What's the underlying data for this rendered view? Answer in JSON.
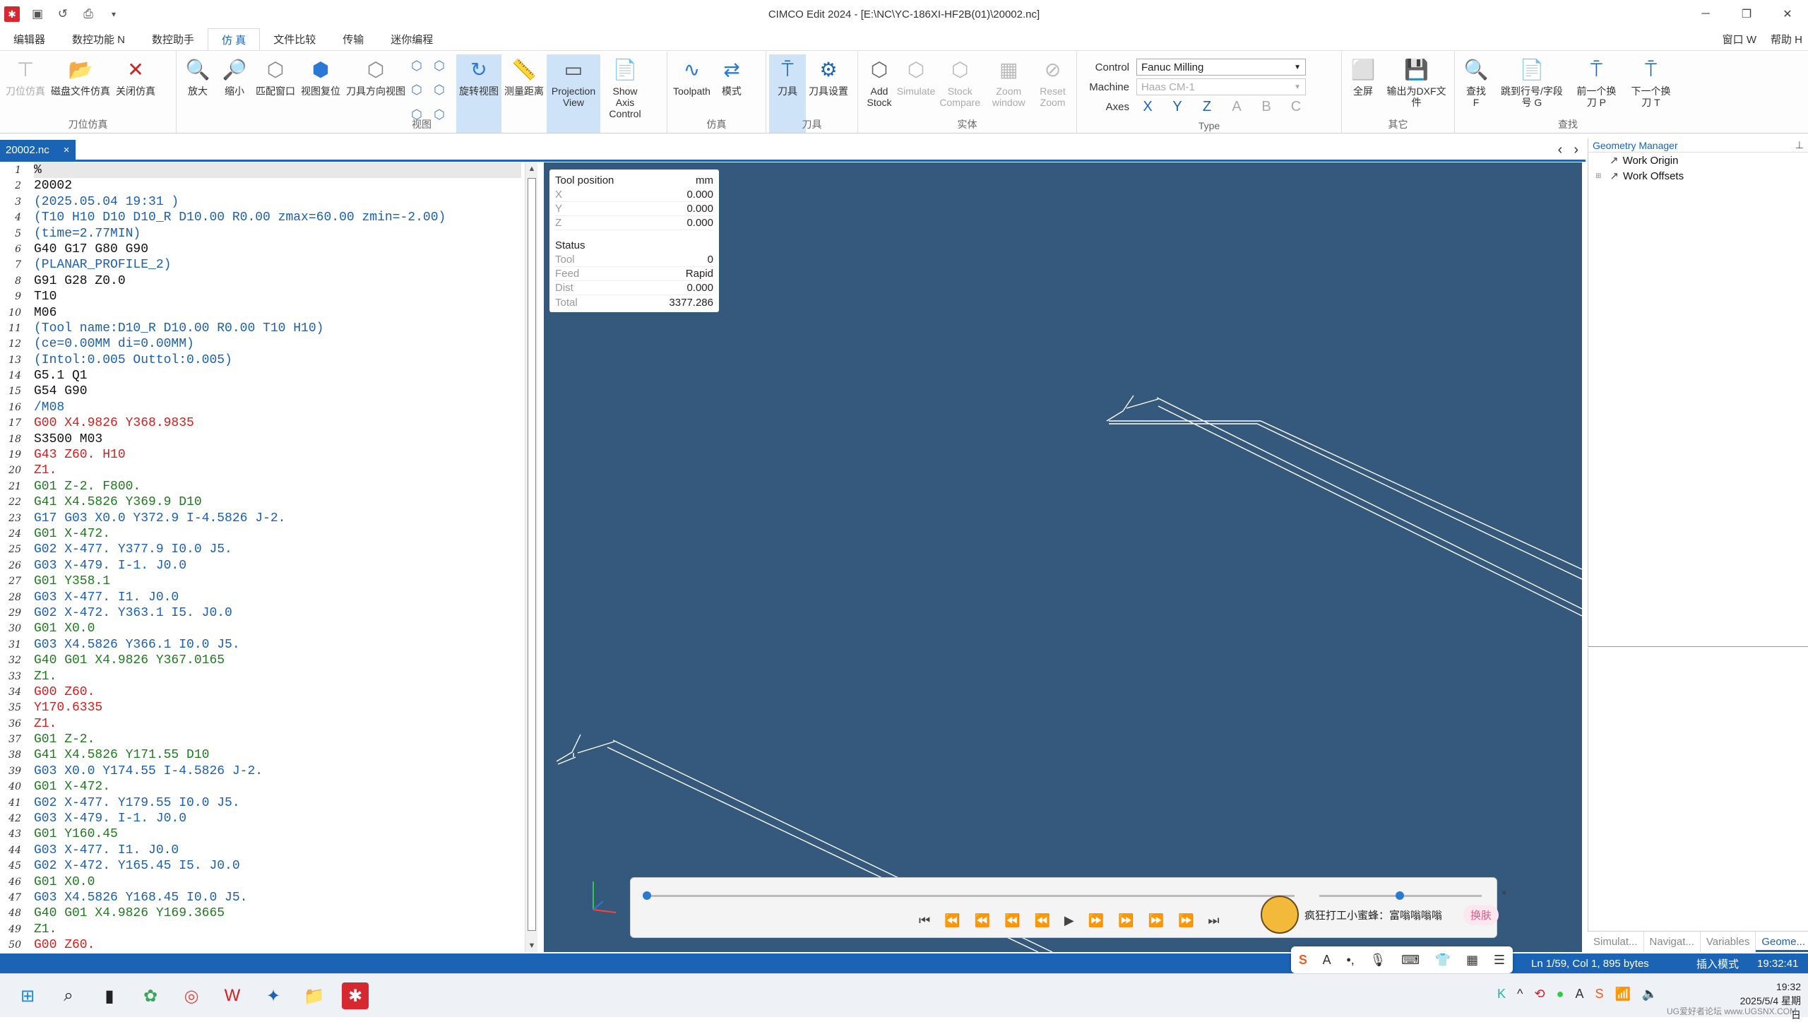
{
  "window": {
    "title": "CIMCO Edit 2024 - [E:\\NC\\YC-186XI-HF2B(01)\\20002.nc]",
    "min_icon": "minimize-icon",
    "restore_icon": "restore-icon",
    "close_icon": "close-icon"
  },
  "menubar": {
    "tabs": [
      "编辑器",
      "数控功能 N",
      "数控助手",
      "仿 真",
      "文件比较",
      "传输",
      "迷你编程"
    ],
    "active": "仿 真",
    "right": [
      "窗口 W",
      "帮助 H"
    ]
  },
  "ribbon": {
    "groups": [
      {
        "label": "刀位仿真",
        "buttons": [
          {
            "label": "刀位仿真",
            "icon": "tool-sim-icon",
            "enabled": false
          },
          {
            "label": "磁盘文件仿真",
            "icon": "folder-icon",
            "enabled": true
          },
          {
            "label": "关闭仿真",
            "icon": "close-x-icon",
            "enabled": true
          }
        ]
      },
      {
        "label": "视图",
        "buttons": [
          {
            "label": "放大",
            "icon": "zoom-in-icon",
            "enabled": true
          },
          {
            "label": "缩小",
            "icon": "zoom-out-icon",
            "enabled": true
          },
          {
            "label": "匹配窗口",
            "icon": "fit-window-icon",
            "enabled": true
          },
          {
            "label": "视图复位",
            "icon": "view-reset-icon",
            "enabled": true
          },
          {
            "label": "刀具方向视图",
            "icon": "tool-direction-icon",
            "enabled": true
          },
          {
            "label": "旋转视图",
            "icon": "rotate-view-icon",
            "enabled": true,
            "selected": true
          },
          {
            "label": "测量距离",
            "icon": "measure-icon",
            "enabled": true
          },
          {
            "label": "Projection View",
            "icon": "projection-icon",
            "enabled": true,
            "selected": true
          },
          {
            "label": "Show Axis Control",
            "icon": "axis-control-icon",
            "enabled": true
          }
        ]
      },
      {
        "label": "仿真",
        "buttons": [
          {
            "label": "Toolpath",
            "icon": "toolpath-icon",
            "enabled": true
          },
          {
            "label": "模式",
            "icon": "mode-icon",
            "enabled": true
          }
        ]
      },
      {
        "label": "刀具",
        "buttons": [
          {
            "label": "刀具",
            "icon": "tool-icon",
            "enabled": true,
            "selected": true
          },
          {
            "label": "刀具设置",
            "icon": "tool-settings-icon",
            "enabled": true
          }
        ]
      },
      {
        "label": "实体",
        "buttons": [
          {
            "label": "Add Stock",
            "icon": "add-stock-icon",
            "enabled": true
          },
          {
            "label": "Simulate",
            "icon": "simulate-icon",
            "enabled": false
          },
          {
            "label": "Stock Compare",
            "icon": "stock-compare-icon",
            "enabled": false
          },
          {
            "label": "Zoom window",
            "icon": "zoom-window-icon",
            "enabled": false
          },
          {
            "label": "Reset Zoom",
            "icon": "reset-zoom-icon",
            "enabled": false
          }
        ]
      },
      {
        "label": "其它",
        "buttons": [
          {
            "label": "全屏",
            "icon": "fullscreen-icon",
            "enabled": true
          },
          {
            "label": "输出为DXF文件",
            "icon": "dxf-icon",
            "enabled": true
          }
        ]
      },
      {
        "label": "查找",
        "buttons": [
          {
            "label": "查找 F",
            "icon": "find-icon",
            "enabled": true
          },
          {
            "label": "跳到行号/字段号 G",
            "icon": "goto-line-icon",
            "enabled": true
          },
          {
            "label": "前一个换刀 P",
            "icon": "prev-tool-icon",
            "enabled": true
          },
          {
            "label": "下一个换刀 T",
            "icon": "next-tool-icon",
            "enabled": true
          }
        ]
      }
    ],
    "type_group": {
      "label": "Type",
      "control_label": "Control",
      "control_value": "Fanuc Milling",
      "machine_label": "Machine",
      "machine_value": "Haas CM-1",
      "axes_label": "Axes",
      "axes": [
        {
          "name": "X",
          "enabled": true
        },
        {
          "name": "Y",
          "enabled": true
        },
        {
          "name": "Z",
          "enabled": true
        },
        {
          "name": "A",
          "enabled": false
        },
        {
          "name": "B",
          "enabled": false
        },
        {
          "name": "C",
          "enabled": false
        }
      ]
    }
  },
  "doc_tab": {
    "label": "20002.nc",
    "close": "×"
  },
  "editor": {
    "lines": [
      {
        "n": "1",
        "t": "%",
        "c": "black"
      },
      {
        "n": "2",
        "t": "20002",
        "c": "black"
      },
      {
        "n": "3",
        "t": "(2025.05.04 19:31 )",
        "c": "blue"
      },
      {
        "n": "4",
        "t": "(T10 H10 D10 D10_R D10.00 R0.00 zmax=60.00 zmin=-2.00)",
        "c": "blue"
      },
      {
        "n": "5",
        "t": "(time=2.77MIN)",
        "c": "blue"
      },
      {
        "n": "6",
        "t": "G40 G17 G80 G90",
        "c": "black"
      },
      {
        "n": "7",
        "t": "(PLANAR_PROFILE_2)",
        "c": "blue"
      },
      {
        "n": "8",
        "t": "G91 G28 Z0.0",
        "c": "black"
      },
      {
        "n": "9",
        "t": "T10",
        "c": "black"
      },
      {
        "n": "10",
        "t": "M06",
        "c": "black"
      },
      {
        "n": "11",
        "t": "(Tool name:D10_R D10.00 R0.00 T10 H10)",
        "c": "blue"
      },
      {
        "n": "12",
        "t": "(ce=0.00MM di=0.00MM)",
        "c": "blue"
      },
      {
        "n": "13",
        "t": "(Intol:0.005 Outtol:0.005)",
        "c": "blue"
      },
      {
        "n": "14",
        "t": "G5.1 Q1",
        "c": "black"
      },
      {
        "n": "15",
        "t": "G54 G90",
        "c": "black"
      },
      {
        "n": "16",
        "t": "/M08",
        "c": "blue"
      },
      {
        "n": "17",
        "t": "G00 X4.9826 Y368.9835",
        "c": "red"
      },
      {
        "n": "18",
        "t": "S3500 M03",
        "c": "black"
      },
      {
        "n": "19",
        "t": "G43 Z60. H10",
        "c": "red"
      },
      {
        "n": "20",
        "t": "Z1.",
        "c": "red"
      },
      {
        "n": "21",
        "t": "G01 Z-2. F800.",
        "c": "green"
      },
      {
        "n": "22",
        "t": "G41 X4.5826 Y369.9 D10",
        "c": "green"
      },
      {
        "n": "23",
        "t": "G17 G03 X0.0 Y372.9 I-4.5826 J-2.",
        "c": "blue"
      },
      {
        "n": "24",
        "t": "G01 X-472.",
        "c": "green"
      },
      {
        "n": "25",
        "t": "G02 X-477. Y377.9 I0.0 J5.",
        "c": "blue"
      },
      {
        "n": "26",
        "t": "G03 X-479. I-1. J0.0",
        "c": "blue"
      },
      {
        "n": "27",
        "t": "G01 Y358.1",
        "c": "green"
      },
      {
        "n": "28",
        "t": "G03 X-477. I1. J0.0",
        "c": "blue"
      },
      {
        "n": "29",
        "t": "G02 X-472. Y363.1 I5. J0.0",
        "c": "blue"
      },
      {
        "n": "30",
        "t": "G01 X0.0",
        "c": "green"
      },
      {
        "n": "31",
        "t": "G03 X4.5826 Y366.1 I0.0 J5.",
        "c": "blue"
      },
      {
        "n": "32",
        "t": "G40 G01 X4.9826 Y367.0165",
        "c": "green"
      },
      {
        "n": "33",
        "t": "Z1.",
        "c": "green"
      },
      {
        "n": "34",
        "t": "G00 Z60.",
        "c": "red"
      },
      {
        "n": "35",
        "t": "Y170.6335",
        "c": "red"
      },
      {
        "n": "36",
        "t": "Z1.",
        "c": "red"
      },
      {
        "n": "37",
        "t": "G01 Z-2.",
        "c": "green"
      },
      {
        "n": "38",
        "t": "G41 X4.5826 Y171.55 D10",
        "c": "green"
      },
      {
        "n": "39",
        "t": "G03 X0.0 Y174.55 I-4.5826 J-2.",
        "c": "blue"
      },
      {
        "n": "40",
        "t": "G01 X-472.",
        "c": "green"
      },
      {
        "n": "41",
        "t": "G02 X-477. Y179.55 I0.0 J5.",
        "c": "blue"
      },
      {
        "n": "42",
        "t": "G03 X-479. I-1. J0.0",
        "c": "blue"
      },
      {
        "n": "43",
        "t": "G01 Y160.45",
        "c": "green"
      },
      {
        "n": "44",
        "t": "G03 X-477. I1. J0.0",
        "c": "blue"
      },
      {
        "n": "45",
        "t": "G02 X-472. Y165.45 I5. J0.0",
        "c": "blue"
      },
      {
        "n": "46",
        "t": "G01 X0.0",
        "c": "green"
      },
      {
        "n": "47",
        "t": "G03 X4.5826 Y168.45 I0.0 J5.",
        "c": "blue"
      },
      {
        "n": "48",
        "t": "G40 G01 X4.9826 Y169.3665",
        "c": "green"
      },
      {
        "n": "49",
        "t": "Z1.",
        "c": "green"
      },
      {
        "n": "50",
        "t": "G00 Z60.",
        "c": "red"
      }
    ]
  },
  "toolpos": {
    "title": "Tool position",
    "unit": "mm",
    "x_label": "X",
    "x": "0.000",
    "y_label": "Y",
    "y": "0.000",
    "z_label": "Z",
    "z": "0.000",
    "status_title": "Status",
    "tool_label": "Tool",
    "tool": "0",
    "feed_label": "Feed",
    "feed": "Rapid",
    "dist_label": "Dist",
    "dist": "0.000",
    "total_label": "Total",
    "total": "3377.286"
  },
  "player": {
    "progress": 0.0,
    "speed": 0.6,
    "close": "×"
  },
  "mascot": {
    "text": "疯狂打工小蜜蜂：富嗡嗡嗡嗡",
    "skin_button": "换肤"
  },
  "geometry_manager": {
    "title": "Geometry Manager",
    "pin": "⊥",
    "items": [
      "Work Origin",
      "Work Offsets"
    ]
  },
  "panel_tabs": [
    {
      "label": "Simulat...",
      "active": false
    },
    {
      "label": "Navigat...",
      "active": false
    },
    {
      "label": "Variables",
      "active": false
    },
    {
      "label": "Geome...",
      "active": true
    }
  ],
  "status": {
    "position": "Ln 1/59, Col 1, 895 bytes",
    "mode": "插入模式",
    "time": "19:32:41"
  },
  "taskbar": {
    "time": "19:32",
    "date": "2025/5/4 星期日",
    "watermark": "UG爱好者论坛 www.UGSNX.COM"
  },
  "colors": {
    "accent": "#1b63b4",
    "viewport_bg": "#35597c",
    "code_blue": "#1b5fb0",
    "code_red": "#d12020",
    "code_green": "#1f7a1f"
  }
}
